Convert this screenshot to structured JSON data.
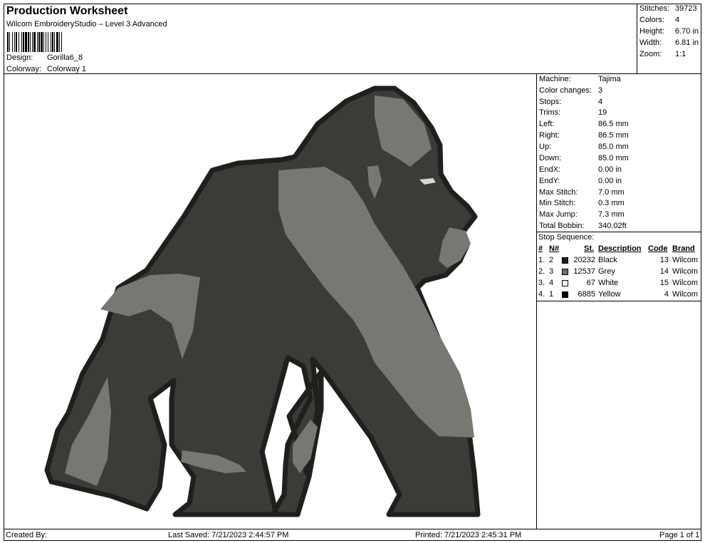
{
  "header": {
    "title": "Production Worksheet",
    "software": "Wilcom EmbroideryStudio – Level 3 Advanced",
    "design_label": "Design:",
    "design_value": "Gorilla6_8",
    "colorway_label": "Colorway:",
    "colorway_value": "Colorway 1"
  },
  "summary": {
    "stitches_label": "Stitches:",
    "stitches": "39723",
    "colors_label": "Colors:",
    "colors": "4",
    "height_label": "Height:",
    "height": "6.70 in",
    "width_label": "Width:",
    "width": "6.81 in",
    "zoom_label": "Zoom:",
    "zoom": "1:1"
  },
  "info": {
    "machine_label": "Machine:",
    "machine": "Tajima",
    "color_changes_label": "Color changes:",
    "color_changes": "3",
    "stops_label": "Stops:",
    "stops": "4",
    "trims_label": "Trims:",
    "trims": "19",
    "left_label": "Left:",
    "left": "86.5 mm",
    "right_label": "Right:",
    "right": "86.5 mm",
    "up_label": "Up:",
    "up": "85.0 mm",
    "down_label": "Down:",
    "down": "85.0 mm",
    "endx_label": "EndX:",
    "endx": "0.00 in",
    "endy_label": "EndY:",
    "endy": "0.00 in",
    "max_stitch_label": "Max Stitch:",
    "max_stitch": "7.0 mm",
    "min_stitch_label": "Min Stitch:",
    "min_stitch": "0.3 mm",
    "max_jump_label": "Max Jump:",
    "max_jump": "7.3 mm",
    "total_bobbin_label": "Total Bobbin:",
    "total_bobbin": "340.02ft"
  },
  "stop_sequence": {
    "title": "Stop Sequence:",
    "headers": {
      "num": "#",
      "n_num": "N#",
      "st": "St.",
      "description": "Description",
      "code": "Code",
      "brand": "Brand"
    },
    "rows": [
      {
        "num": "1.",
        "n": "2",
        "swatch": "#1e1e1e",
        "st": "20232",
        "description": "Black",
        "code": "13",
        "brand": "Wilcom"
      },
      {
        "num": "2.",
        "n": "3",
        "swatch": "#6e6e6e",
        "st": "12537",
        "description": "Grey",
        "code": "14",
        "brand": "Wilcom"
      },
      {
        "num": "3.",
        "n": "4",
        "swatch": "#ffffff",
        "st": "67",
        "description": "White",
        "code": "15",
        "brand": "Wilcom"
      },
      {
        "num": "4.",
        "n": "1",
        "swatch": "#000000",
        "st": "6885",
        "description": "Yellow",
        "code": "4",
        "brand": "Wilcom"
      }
    ]
  },
  "footer": {
    "created_by": "Created By:",
    "last_saved": "Last Saved: 7/21/2023 2:44:57 PM",
    "printed": "Printed: 7/21/2023 2:45:31 PM",
    "page": "Page 1 of 1"
  },
  "colors": {
    "outline": "#1f1f1d",
    "dark_fill": "#3c3b37",
    "grey_fill": "#767872",
    "eye": "#d8d8d6"
  }
}
